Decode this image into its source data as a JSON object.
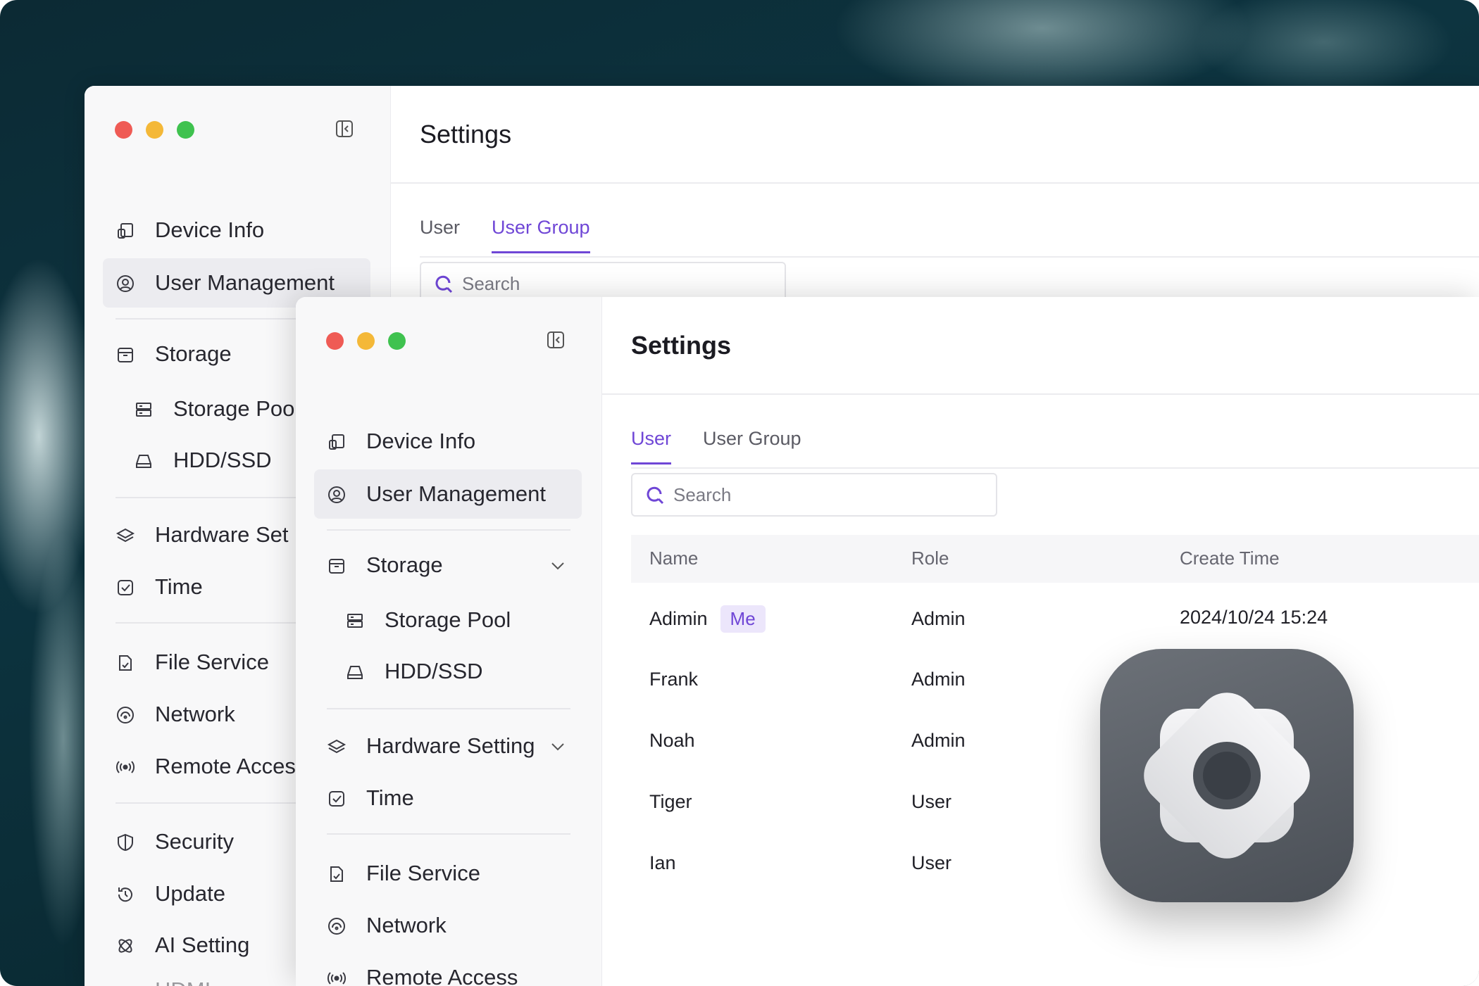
{
  "back_window": {
    "title": "Settings",
    "tabs": [
      {
        "label": "User",
        "active": false
      },
      {
        "label": "User Group",
        "active": true
      }
    ],
    "search_placeholder": "Search",
    "nav": [
      {
        "label": "Device Info",
        "icon": "device-info-icon"
      },
      {
        "label": "User Management",
        "icon": "user-circle-icon",
        "active": true
      },
      {
        "label": "Storage",
        "icon": "storage-icon"
      },
      {
        "label": "Storage Poo",
        "icon": "storage-pool-icon",
        "sub": true
      },
      {
        "label": "HDD/SSD",
        "icon": "hdd-icon",
        "sub": true
      },
      {
        "label": "Hardware Set",
        "icon": "hardware-icon"
      },
      {
        "label": "Time",
        "icon": "time-icon"
      },
      {
        "label": "File Service",
        "icon": "file-service-icon"
      },
      {
        "label": "Network",
        "icon": "network-icon"
      },
      {
        "label": "Remote Acces",
        "icon": "remote-access-icon"
      },
      {
        "label": "Security",
        "icon": "security-icon"
      },
      {
        "label": "Update",
        "icon": "update-icon"
      },
      {
        "label": "AI Setting",
        "icon": "ai-setting-icon"
      },
      {
        "label": "HDMI",
        "icon": "hdmi-icon"
      }
    ]
  },
  "front_window": {
    "title": "Settings",
    "tabs": [
      {
        "label": "User",
        "active": true
      },
      {
        "label": "User Group",
        "active": false
      }
    ],
    "search_placeholder": "Search",
    "nav": [
      {
        "label": "Device Info",
        "icon": "device-info-icon"
      },
      {
        "label": "User Management",
        "icon": "user-circle-icon",
        "active": true
      },
      {
        "label": "Storage",
        "icon": "storage-icon",
        "expandable": true
      },
      {
        "label": "Storage Pool",
        "icon": "storage-pool-icon",
        "sub": true
      },
      {
        "label": "HDD/SSD",
        "icon": "hdd-icon",
        "sub": true
      },
      {
        "label": "Hardware Setting",
        "icon": "hardware-icon",
        "expandable": true
      },
      {
        "label": "Time",
        "icon": "time-icon"
      },
      {
        "label": "File Service",
        "icon": "file-service-icon"
      },
      {
        "label": "Network",
        "icon": "network-icon"
      },
      {
        "label": "Remote Access",
        "icon": "remote-access-icon"
      }
    ],
    "table": {
      "columns": [
        "Name",
        "Role",
        "Create Time"
      ],
      "rows": [
        {
          "name": "Adimin",
          "badge": "Me",
          "role": "Admin",
          "create_time": "2024/10/24 15:24"
        },
        {
          "name": "Frank",
          "role": "Admin"
        },
        {
          "name": "Noah",
          "role": "Admin"
        },
        {
          "name": "Tiger",
          "role": "User"
        },
        {
          "name": "Ian",
          "role": "User"
        }
      ]
    }
  },
  "colors": {
    "accent": "#6f46d6",
    "light_red": "#ef5b55",
    "light_yellow": "#f4b838",
    "light_green": "#3fc24f"
  },
  "app_icon": "settings-gear-icon"
}
